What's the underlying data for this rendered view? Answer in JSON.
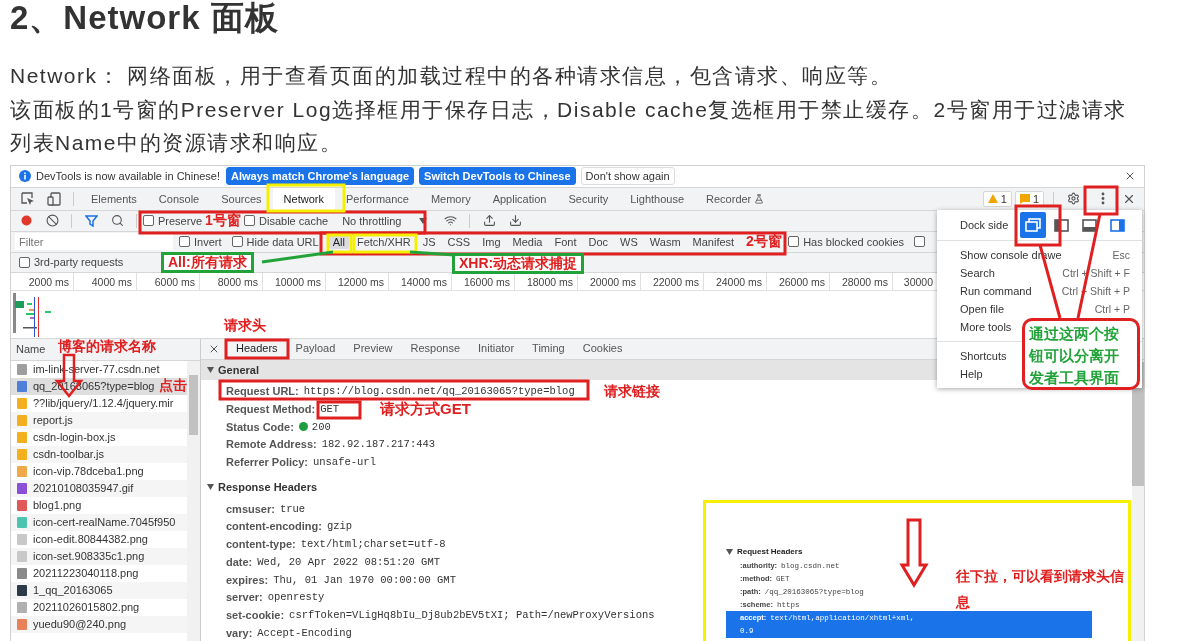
{
  "article": {
    "heading": "2、Network 面板",
    "paragraphs": [
      "Network： 网络面板，用于查看页面的加载过程中的各种请求信息，包含请求、响应等。",
      "该面板的1号窗的Preserver Log选择框用于保存日志，Disable cache复选框用于禁止缓存。2号窗用于过滤请求列表Name中的资源请求和响应。"
    ]
  },
  "devtools": {
    "infobar": {
      "message": "DevTools is now available in Chinese!",
      "buttons": [
        {
          "label": "Always match Chrome's language",
          "kind": "primary"
        },
        {
          "label": "Switch DevTools to Chinese",
          "kind": "primary"
        },
        {
          "label": "Don't show again",
          "kind": "plain"
        }
      ]
    },
    "tabs": [
      {
        "label": "Elements",
        "selected": false,
        "experimental": false
      },
      {
        "label": "Console",
        "selected": false,
        "experimental": false
      },
      {
        "label": "Sources",
        "selected": false,
        "experimental": false
      },
      {
        "label": "Network",
        "selected": true,
        "experimental": false
      },
      {
        "label": "Performance",
        "selected": false,
        "experimental": false
      },
      {
        "label": "Memory",
        "selected": false,
        "experimental": false
      },
      {
        "label": "Application",
        "selected": false,
        "experimental": false
      },
      {
        "label": "Security",
        "selected": false,
        "experimental": false
      },
      {
        "label": "Lighthouse",
        "selected": false,
        "experimental": false
      },
      {
        "label": "Recorder",
        "selected": false,
        "experimental": true
      }
    ],
    "issues": {
      "warnings": "1",
      "messages": "1"
    },
    "toolbar": {
      "recording": true,
      "checkboxes": [
        {
          "label": "Preserve",
          "checked": false
        },
        {
          "label": "Disable cache",
          "checked": false
        }
      ],
      "throttling": "No throttling"
    },
    "filter": {
      "placeholder": "Filter",
      "checkboxes_before": [
        {
          "label": "Invert",
          "checked": false
        },
        {
          "label": "Hide data URL",
          "checked": false
        }
      ],
      "types": [
        {
          "label": "All",
          "selected": true
        },
        {
          "label": "Fetch/XHR",
          "selected": false
        },
        {
          "label": "JS",
          "selected": false
        },
        {
          "label": "CSS",
          "selected": false
        },
        {
          "label": "Img",
          "selected": false
        },
        {
          "label": "Media",
          "selected": false
        },
        {
          "label": "Font",
          "selected": false
        },
        {
          "label": "Doc",
          "selected": false
        },
        {
          "label": "WS",
          "selected": false
        },
        {
          "label": "Wasm",
          "selected": false
        },
        {
          "label": "Manifest",
          "selected": false
        }
      ],
      "checkboxes_after": [
        {
          "label": "Has blocked cookies",
          "checked": false
        },
        {
          "checked": false
        }
      ],
      "third_party": {
        "label": "3rd-party requests",
        "checked": false
      }
    },
    "timeline_ticks": [
      "2000 ms",
      "4000 ms",
      "6000 ms",
      "8000 ms",
      "10000 ms",
      "12000 ms",
      "14000 ms",
      "16000 ms",
      "18000 ms",
      "20000 ms",
      "22000 ms",
      "24000 ms",
      "26000 ms",
      "28000 ms",
      "30000"
    ],
    "requests": {
      "column": "Name",
      "rows": [
        {
          "name": "im-link-server-77.csdn.net",
          "selected": false,
          "color": "#9e9e9e"
        },
        {
          "name": "qq_20163065?type=blog",
          "selected": true,
          "color": "#4f7fd9"
        },
        {
          "name": "??lib/jquery/1.12.4/jquery.mir",
          "selected": false,
          "color": "#f2b01e"
        },
        {
          "name": "report.js",
          "selected": false,
          "color": "#f2b01e"
        },
        {
          "name": "csdn-login-box.js",
          "selected": false,
          "color": "#f2b01e"
        },
        {
          "name": "csdn-toolbar.js",
          "selected": false,
          "color": "#f2b01e"
        },
        {
          "name": "icon-vip.78dceba1.png",
          "selected": false,
          "color": "#f0a94a"
        },
        {
          "name": "20210108035947.gif",
          "selected": false,
          "color": "#8a4fd6"
        },
        {
          "name": "blog1.png",
          "selected": false,
          "color": "#e05858"
        },
        {
          "name": "icon-cert-realName.7045f950",
          "selected": false,
          "color": "#4cc4b0"
        },
        {
          "name": "icon-edit.80844382.png",
          "selected": false,
          "color": "#c8c8c8"
        },
        {
          "name": "icon-set.908335c1.png",
          "selected": false,
          "color": "#c8c8c8"
        },
        {
          "name": "20211223040118.png",
          "selected": false,
          "color": "#8a8a8a"
        },
        {
          "name": "1_qq_20163065",
          "selected": false,
          "color": "#2d3a4a"
        },
        {
          "name": "20211026015802.png",
          "selected": false,
          "color": "#b0b0b0"
        },
        {
          "name": "yuedu90@240.png",
          "selected": false,
          "color": "#e8805a"
        }
      ]
    },
    "detail": {
      "tabs": [
        {
          "label": "Headers",
          "selected": true
        },
        {
          "label": "Payload",
          "selected": false
        },
        {
          "label": "Preview",
          "selected": false
        },
        {
          "label": "Response",
          "selected": false
        },
        {
          "label": "Initiator",
          "selected": false
        },
        {
          "label": "Timing",
          "selected": false
        },
        {
          "label": "Cookies",
          "selected": false
        }
      ],
      "sections": [
        {
          "title": "General",
          "kind": "shaded",
          "rows": [
            {
              "key": "Request URL:",
              "value": "https://blog.csdn.net/qq_20163065?type=blog"
            },
            {
              "key": "Request Method:",
              "value": "GET"
            },
            {
              "key": "Status Code:",
              "value": "200",
              "color": "#1e9e3e"
            },
            {
              "key": "Remote Address:",
              "value": "182.92.187.217:443"
            },
            {
              "key": "Referrer Policy:",
              "value": "unsafe-url"
            }
          ]
        },
        {
          "title": "Response Headers",
          "kind": "plain",
          "rows": [
            {
              "key": "cmsuser:",
              "value": "true"
            },
            {
              "key": "content-encoding:",
              "value": "gzip"
            },
            {
              "key": "content-type:",
              "value": "text/html;charset=utf-8"
            },
            {
              "key": "date:",
              "value": "Wed, 20 Apr 2022 08:51:20 GMT"
            },
            {
              "key": "expires:",
              "value": "Thu, 01 Jan 1970 00:00:00 GMT"
            },
            {
              "key": "server:",
              "value": "openresty"
            },
            {
              "key": "set-cookie:",
              "value": "csrfToken=VLigHq8bIu_Dj8ub2bEV5tXI; Path=/newProxyVersions"
            },
            {
              "key": "vary:",
              "value": "Accept-Encoding"
            }
          ]
        }
      ]
    },
    "menu": {
      "dock_label": "Dock side",
      "dock_options": [
        {
          "kind": "undock",
          "selected": true
        },
        {
          "kind": "left",
          "selected": false
        },
        {
          "kind": "bottom",
          "selected": false
        },
        {
          "kind": "right",
          "selected": false
        }
      ],
      "groups": [
        [
          {
            "label": "Show console drawe",
            "shortcut": "Esc"
          },
          {
            "label": "Search",
            "shortcut": "Ctrl + Shift + F"
          },
          {
            "label": "Run command",
            "shortcut": "Ctrl + Shift + P"
          },
          {
            "label": "Open file",
            "shortcut": "Ctrl + P"
          },
          {
            "label": "More tools"
          }
        ],
        [
          {
            "label": "Shortcuts"
          },
          {
            "label": "Help"
          }
        ]
      ]
    }
  },
  "inset": {
    "title": "Request Headers",
    "rows": [
      {
        "key": ":authority:",
        "value": "blog.csdn.net",
        "selected": false
      },
      {
        "key": ":method:",
        "value": "GET",
        "selected": false
      },
      {
        "key": ":path:",
        "value": "/qq_20163065?type=blog",
        "selected": false
      },
      {
        "key": ":scheme:",
        "value": "https",
        "selected": false
      },
      {
        "key": "accept:",
        "value": "text/html,application/xhtml+xml,",
        "selected": true
      }
    ],
    "continuation": "0.9"
  },
  "annotations": [
    {
      "text": "1号窗",
      "color": "#e02020",
      "kind": "plain"
    },
    {
      "text": "2号窗",
      "color": "#e02020",
      "kind": "plain"
    },
    {
      "text": "All:所有请求",
      "color": "#e02020",
      "kind": "boxed"
    },
    {
      "text": "XHR:动态请求捕捉",
      "color": "#e02020",
      "kind": "boxed"
    },
    {
      "text": "请求头",
      "color": "#e02020",
      "kind": "plain"
    },
    {
      "text": "博客的请求名称",
      "color": "#e02020",
      "kind": "plain"
    },
    {
      "text": "点击",
      "color": "#e02020",
      "kind": "plain"
    },
    {
      "text": "请求链接",
      "color": "#e02020",
      "kind": "plain"
    },
    {
      "text": "请求方式GET",
      "color": "#e02020",
      "kind": "plain"
    },
    {
      "text": "通过这两个按钮可以分离开发者工具界面",
      "color": "#22a33a",
      "kind": "bubble"
    },
    {
      "text": "往下拉，可以看到请求头信息",
      "color": "#e02020",
      "kind": "plain"
    }
  ]
}
